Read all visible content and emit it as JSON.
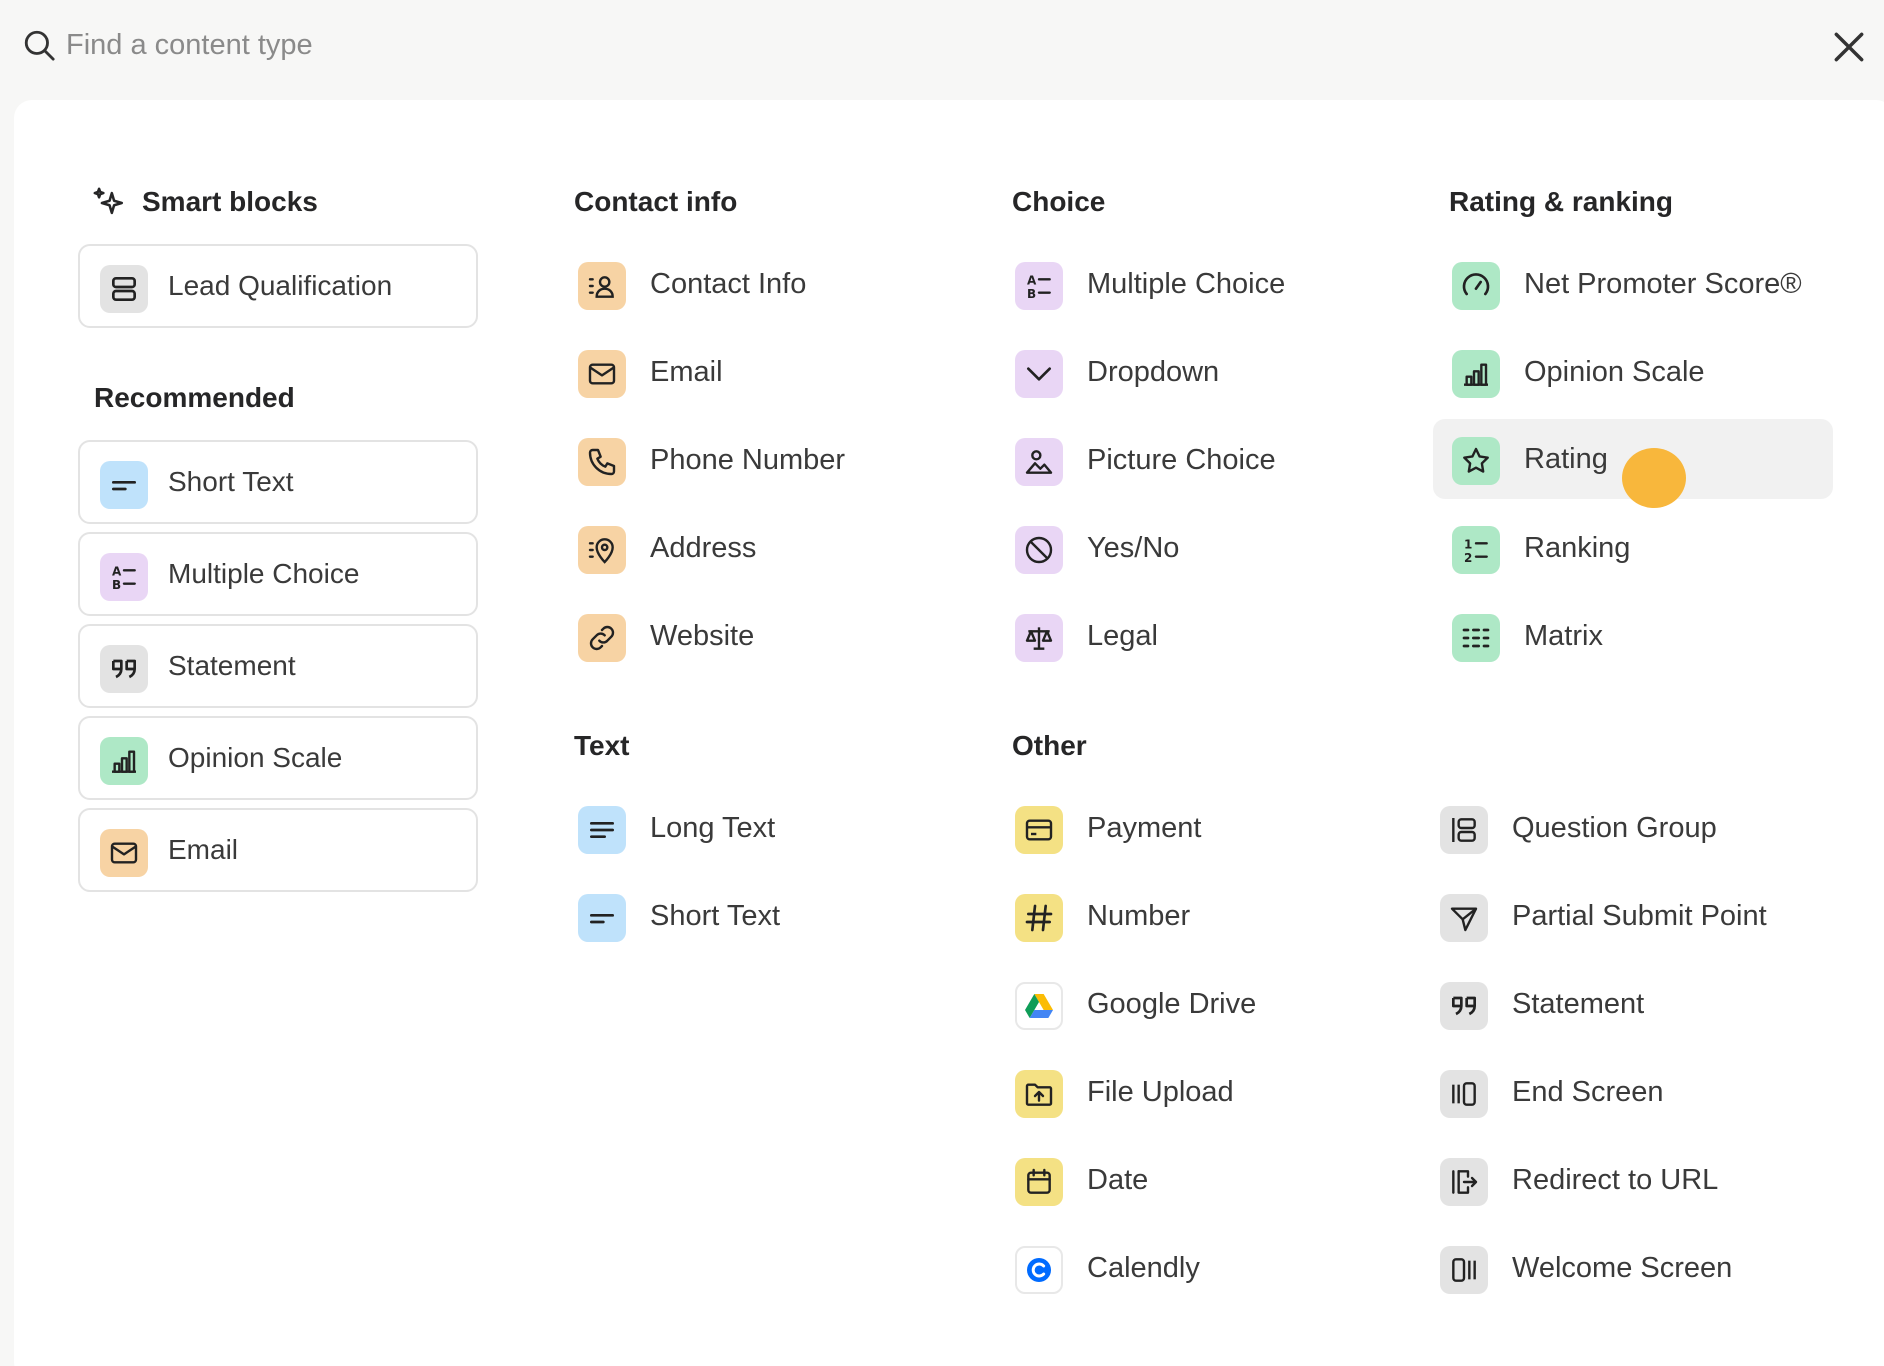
{
  "search": {
    "placeholder": "Find a content type",
    "value": ""
  },
  "sections": {
    "smart_blocks": "Smart blocks",
    "recommended": "Recommended",
    "contact_info": "Contact info",
    "text": "Text",
    "choice": "Choice",
    "other": "Other",
    "rating_ranking": "Rating & ranking"
  },
  "smart_blocks": {
    "lead_qualification": "Lead Qualification"
  },
  "recommended": {
    "short_text": "Short Text",
    "multiple_choice": "Multiple Choice",
    "statement": "Statement",
    "opinion_scale": "Opinion Scale",
    "email": "Email"
  },
  "contact": {
    "contact_info": "Contact Info",
    "email": "Email",
    "phone_number": "Phone Number",
    "address": "Address",
    "website": "Website"
  },
  "text": {
    "long_text": "Long Text",
    "short_text": "Short Text"
  },
  "choice": {
    "multiple_choice": "Multiple Choice",
    "dropdown": "Dropdown",
    "picture_choice": "Picture Choice",
    "yes_no": "Yes/No",
    "legal": "Legal"
  },
  "other": {
    "payment": "Payment",
    "number": "Number",
    "google_drive": "Google Drive",
    "file_upload": "File Upload",
    "date": "Date",
    "calendly": "Calendly",
    "question_group": "Question Group",
    "partial_submit_point": "Partial Submit Point",
    "statement": "Statement",
    "end_screen": "End Screen",
    "redirect_to_url": "Redirect to URL",
    "welcome_screen": "Welcome Screen"
  },
  "rating": {
    "nps": "Net Promoter Score®",
    "opinion_scale": "Opinion Scale",
    "rating": "Rating",
    "ranking": "Ranking",
    "matrix": "Matrix"
  },
  "state": {
    "hovered_item": "Rating"
  },
  "colors": {
    "gray": "#e3e3e3",
    "blue": "#bfe2fb",
    "purple": "#e9d6f5",
    "green": "#aee8c6",
    "orange": "#f7d3a4",
    "yellow": "#f4e184",
    "cursor": "#f8b73c"
  }
}
